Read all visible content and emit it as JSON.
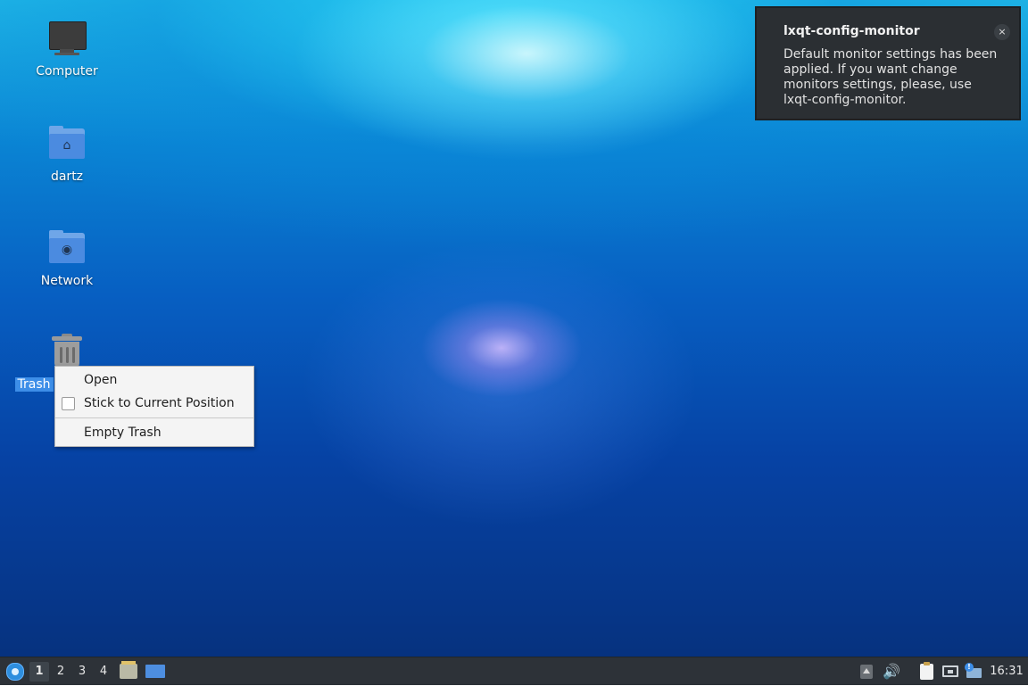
{
  "desktop": {
    "icons": [
      {
        "label": "Computer",
        "icon": "computer-icon"
      },
      {
        "label": "dartz",
        "icon": "home-folder-icon"
      },
      {
        "label": "Network",
        "icon": "network-folder-icon"
      },
      {
        "label": "Trash",
        "icon": "trash-icon",
        "selected": true
      }
    ]
  },
  "context_menu": {
    "open": "Open",
    "stick": "Stick to Current Position",
    "stick_checked": false,
    "empty_trash": "Empty Trash"
  },
  "notification": {
    "title": "lxqt-config-monitor",
    "body": "Default monitor settings has been applied. If you want change monitors settings, please, use lxqt-config-monitor.",
    "close_glyph": "×"
  },
  "taskbar": {
    "workspaces": [
      "1",
      "2",
      "3",
      "4"
    ],
    "active_workspace": "1",
    "clock": "16:31",
    "volume_glyph": "🔊",
    "alert_glyph": "!"
  },
  "colors": {
    "selection": "#3d8ee8",
    "panel": "#2d3238",
    "notification_bg": "#2b2f33"
  }
}
